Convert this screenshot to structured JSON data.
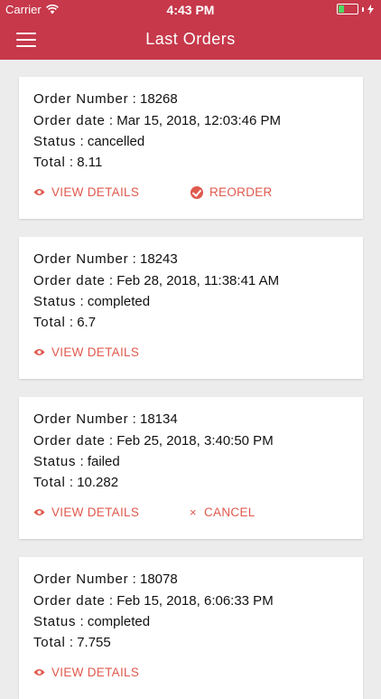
{
  "status_bar": {
    "carrier": "Carrier",
    "time": "4:43 PM"
  },
  "header": {
    "title": "Last Orders"
  },
  "labels": {
    "order_number": "Order Number",
    "order_date": "Order date",
    "status": "Status",
    "total": "Total",
    "separator": ":"
  },
  "actions": {
    "view_details": "VIEW DETAILS",
    "reorder": "REORDER",
    "cancel": "CANCEL"
  },
  "orders": [
    {
      "number": "18268",
      "date": "Mar 15, 2018, 12:03:46 PM",
      "status": "cancelled",
      "total": "8.11"
    },
    {
      "number": "18243",
      "date": "Feb 28, 2018, 11:38:41 AM",
      "status": "completed",
      "total": "6.7"
    },
    {
      "number": "18134",
      "date": "Feb 25, 2018, 3:40:50 PM",
      "status": "failed",
      "total": "10.282"
    },
    {
      "number": "18078",
      "date": "Feb 15, 2018, 6:06:33 PM",
      "status": "completed",
      "total": "7.755"
    }
  ],
  "colors": {
    "accent": "#c6384a",
    "action": "#e0594d",
    "background": "#ececec",
    "battery": "#4cd964"
  }
}
